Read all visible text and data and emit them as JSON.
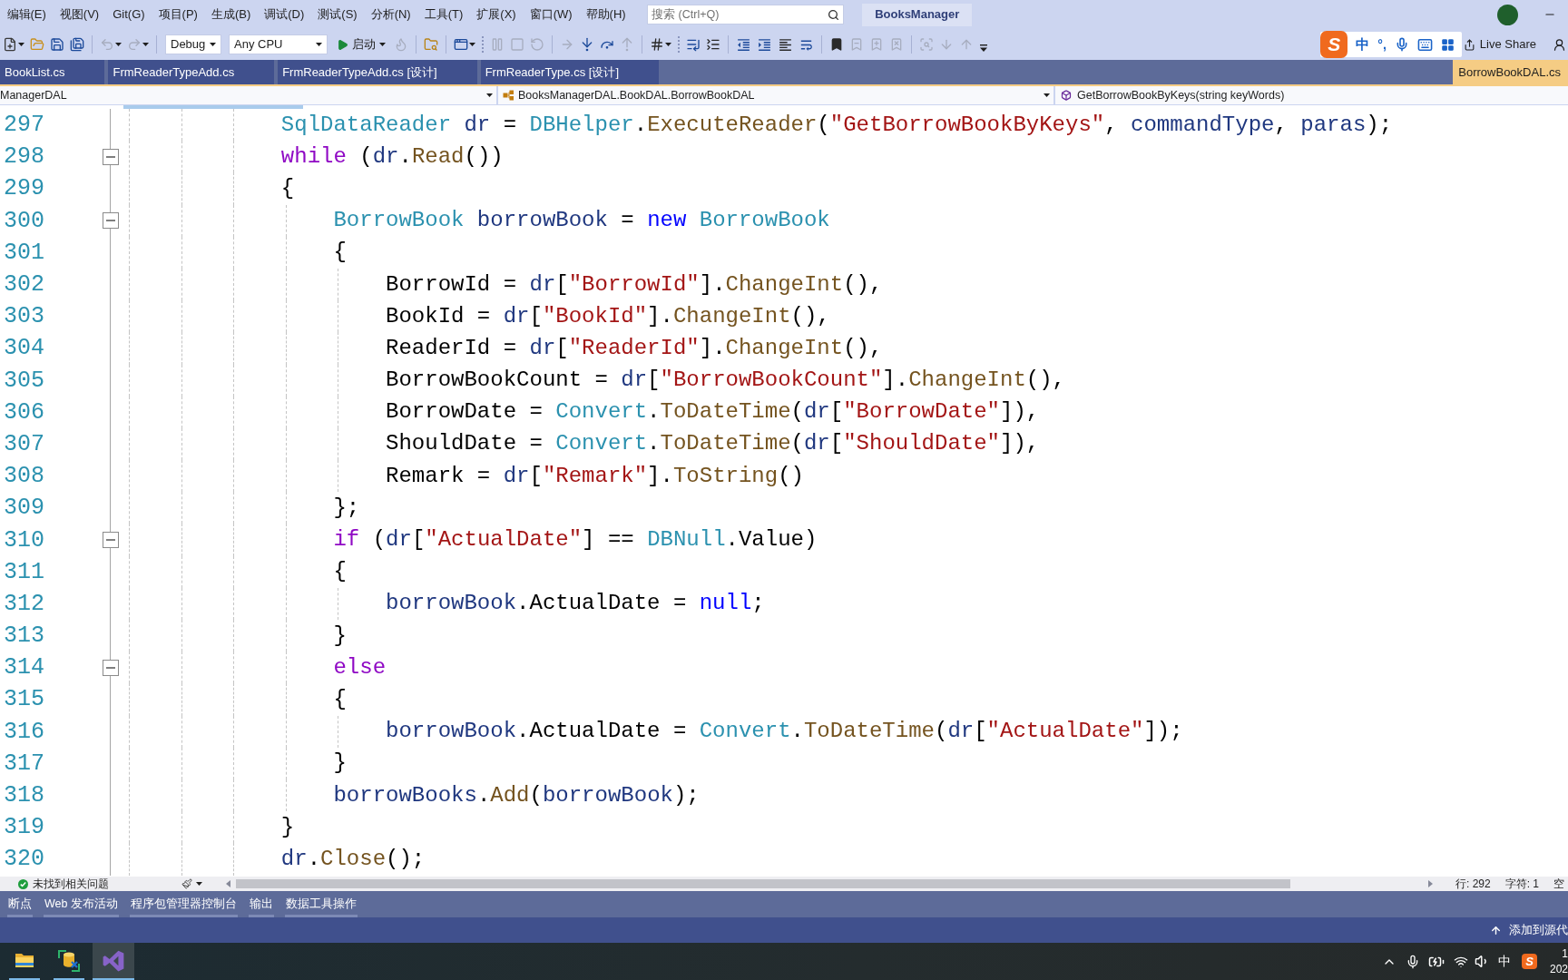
{
  "menu_bar": {
    "items": [
      "编辑(E)",
      "视图(V)",
      "Git(G)",
      "项目(P)",
      "生成(B)",
      "调试(D)",
      "测试(S)",
      "分析(N)",
      "工具(T)",
      "扩展(X)",
      "窗口(W)",
      "帮助(H)"
    ],
    "search": {
      "placeholder": "搜索 (Ctrl+Q)"
    },
    "solution": "BooksManager"
  },
  "toolbar": {
    "items": [
      {
        "kind": "new",
        "disabled": false,
        "caret": true
      },
      {
        "kind": "open",
        "disabled": false
      },
      {
        "kind": "save",
        "disabled": false
      },
      {
        "kind": "save_all",
        "disabled": false
      },
      {
        "kind": "separator"
      },
      {
        "kind": "undo",
        "disabled": true,
        "caret": true
      },
      {
        "kind": "redo",
        "disabled": true,
        "caret": true
      },
      {
        "kind": "separator"
      },
      {
        "kind": "select",
        "value": "Debug"
      },
      {
        "kind": "select",
        "value": "Any CPU"
      },
      {
        "kind": "start",
        "label": "启动"
      },
      {
        "kind": "hot_reload",
        "disabled": true
      },
      {
        "kind": "separator"
      },
      {
        "kind": "find_in_files",
        "disabled": false
      },
      {
        "kind": "separator"
      },
      {
        "kind": "window",
        "disabled": false,
        "caret": true
      },
      {
        "kind": "grip"
      },
      {
        "kind": "pause",
        "disabled": true
      },
      {
        "kind": "stop",
        "disabled": true
      },
      {
        "kind": "restart",
        "disabled": true
      },
      {
        "kind": "separator"
      },
      {
        "kind": "show_next",
        "disabled": true
      },
      {
        "kind": "step_into",
        "disabled": false
      },
      {
        "kind": "step_over",
        "disabled": false
      },
      {
        "kind": "step_out",
        "disabled": true
      },
      {
        "kind": "separator"
      },
      {
        "kind": "hash",
        "disabled": false,
        "caret": true
      },
      {
        "kind": "grip"
      },
      {
        "kind": "list_end",
        "disabled": false
      },
      {
        "kind": "list_collapse",
        "disabled": false
      },
      {
        "kind": "separator"
      },
      {
        "kind": "outdent",
        "disabled": false
      },
      {
        "kind": "indent",
        "disabled": false
      },
      {
        "kind": "comment",
        "disabled": false
      },
      {
        "kind": "uncomment",
        "disabled": false
      },
      {
        "kind": "separator"
      },
      {
        "kind": "bookmark",
        "disabled": false
      },
      {
        "kind": "bookmark_prev",
        "disabled": true
      },
      {
        "kind": "bookmark_next",
        "disabled": true
      },
      {
        "kind": "bookmark_clear",
        "disabled": true
      },
      {
        "kind": "separator"
      },
      {
        "kind": "find",
        "disabled": true
      },
      {
        "kind": "move_down",
        "disabled": true
      },
      {
        "kind": "move_up",
        "disabled": true
      },
      {
        "kind": "overflow",
        "disabled": false
      }
    ],
    "ime_bar": {
      "logo": "S",
      "mode": "中",
      "punctuation": "°,"
    },
    "live_share": "Live Share"
  },
  "tabs": [
    {
      "label": "BookList.cs",
      "kind": "document",
      "selected": false
    },
    {
      "label": "FrmReaderTypeAdd.cs",
      "kind": "document",
      "selected": false
    },
    {
      "label": "FrmReaderTypeAdd.cs [设计]",
      "kind": "document",
      "selected": false
    },
    {
      "label": "FrmReaderType.cs [设计]",
      "kind": "document",
      "selected": false
    },
    {
      "label": "BorrowBookDAL.cs",
      "kind": "preview",
      "selected": true
    }
  ],
  "navigation_bar": {
    "project": "ManagerDAL",
    "type": "BooksManagerDAL.BookDAL.BorrowBookDAL",
    "member": "GetBorrowBookByKeys(string keyWords)"
  },
  "editor": {
    "lines": [
      {
        "number": "297",
        "tokens": [
          {
            "text": "            SqlDataReader",
            "kind": "type"
          },
          {
            "text": " dr",
            "kind": "local"
          },
          {
            "text": " = ",
            "kind": "plain"
          },
          {
            "text": "DBHelper",
            "kind": "type"
          },
          {
            "text": ".",
            "kind": "plain"
          },
          {
            "text": "ExecuteReader",
            "kind": "method"
          },
          {
            "text": "(",
            "kind": "plain"
          },
          {
            "text": "\"GetBorrowBookByKeys\"",
            "kind": "string"
          },
          {
            "text": ", ",
            "kind": "plain"
          },
          {
            "text": "commandType",
            "kind": "local"
          },
          {
            "text": ", ",
            "kind": "plain"
          },
          {
            "text": "paras",
            "kind": "local"
          },
          {
            "text": ");",
            "kind": "plain"
          }
        ]
      },
      {
        "number": "298",
        "expanded": true,
        "tokens": [
          {
            "text": "            while",
            "kind": "control"
          },
          {
            "text": " (",
            "kind": "plain"
          },
          {
            "text": "dr",
            "kind": "local"
          },
          {
            "text": ".",
            "kind": "plain"
          },
          {
            "text": "Read",
            "kind": "method"
          },
          {
            "text": "())",
            "kind": "plain"
          }
        ]
      },
      {
        "number": "299",
        "tokens": [
          {
            "text": "            {",
            "kind": "plain"
          }
        ]
      },
      {
        "number": "300",
        "expanded": true,
        "tokens": [
          {
            "text": "                BorrowBook",
            "kind": "type"
          },
          {
            "text": " borrowBook",
            "kind": "local"
          },
          {
            "text": " = ",
            "kind": "plain"
          },
          {
            "text": "new",
            "kind": "keyword"
          },
          {
            "text": " BorrowBook",
            "kind": "type"
          }
        ]
      },
      {
        "number": "301",
        "tokens": [
          {
            "text": "                {",
            "kind": "plain"
          }
        ]
      },
      {
        "number": "302",
        "tokens": [
          {
            "text": "                    BorrowId = ",
            "kind": "plain"
          },
          {
            "text": "dr",
            "kind": "local"
          },
          {
            "text": "[",
            "kind": "plain"
          },
          {
            "text": "\"BorrowId\"",
            "kind": "string"
          },
          {
            "text": "].",
            "kind": "plain"
          },
          {
            "text": "ChangeInt",
            "kind": "method"
          },
          {
            "text": "(),",
            "kind": "plain"
          }
        ]
      },
      {
        "number": "303",
        "tokens": [
          {
            "text": "                    BookId = ",
            "kind": "plain"
          },
          {
            "text": "dr",
            "kind": "local"
          },
          {
            "text": "[",
            "kind": "plain"
          },
          {
            "text": "\"BookId\"",
            "kind": "string"
          },
          {
            "text": "].",
            "kind": "plain"
          },
          {
            "text": "ChangeInt",
            "kind": "method"
          },
          {
            "text": "(),",
            "kind": "plain"
          }
        ]
      },
      {
        "number": "304",
        "tokens": [
          {
            "text": "                    ReaderId = ",
            "kind": "plain"
          },
          {
            "text": "dr",
            "kind": "local"
          },
          {
            "text": "[",
            "kind": "plain"
          },
          {
            "text": "\"ReaderId\"",
            "kind": "string"
          },
          {
            "text": "].",
            "kind": "plain"
          },
          {
            "text": "ChangeInt",
            "kind": "method"
          },
          {
            "text": "(),",
            "kind": "plain"
          }
        ]
      },
      {
        "number": "305",
        "tokens": [
          {
            "text": "                    BorrowBookCount = ",
            "kind": "plain"
          },
          {
            "text": "dr",
            "kind": "local"
          },
          {
            "text": "[",
            "kind": "plain"
          },
          {
            "text": "\"BorrowBookCount\"",
            "kind": "string"
          },
          {
            "text": "].",
            "kind": "plain"
          },
          {
            "text": "ChangeInt",
            "kind": "method"
          },
          {
            "text": "(),",
            "kind": "plain"
          }
        ]
      },
      {
        "number": "306",
        "tokens": [
          {
            "text": "                    BorrowDate = ",
            "kind": "plain"
          },
          {
            "text": "Convert",
            "kind": "type"
          },
          {
            "text": ".",
            "kind": "plain"
          },
          {
            "text": "ToDateTime",
            "kind": "method"
          },
          {
            "text": "(",
            "kind": "plain"
          },
          {
            "text": "dr",
            "kind": "local"
          },
          {
            "text": "[",
            "kind": "plain"
          },
          {
            "text": "\"BorrowDate\"",
            "kind": "string"
          },
          {
            "text": "]),",
            "kind": "plain"
          }
        ]
      },
      {
        "number": "307",
        "tokens": [
          {
            "text": "                    ShouldDate = ",
            "kind": "plain"
          },
          {
            "text": "Convert",
            "kind": "type"
          },
          {
            "text": ".",
            "kind": "plain"
          },
          {
            "text": "ToDateTime",
            "kind": "method"
          },
          {
            "text": "(",
            "kind": "plain"
          },
          {
            "text": "dr",
            "kind": "local"
          },
          {
            "text": "[",
            "kind": "plain"
          },
          {
            "text": "\"ShouldDate\"",
            "kind": "string"
          },
          {
            "text": "]),",
            "kind": "plain"
          }
        ]
      },
      {
        "number": "308",
        "tokens": [
          {
            "text": "                    Remark = ",
            "kind": "plain"
          },
          {
            "text": "dr",
            "kind": "local"
          },
          {
            "text": "[",
            "kind": "plain"
          },
          {
            "text": "\"Remark\"",
            "kind": "string"
          },
          {
            "text": "].",
            "kind": "plain"
          },
          {
            "text": "ToString",
            "kind": "method"
          },
          {
            "text": "()",
            "kind": "plain"
          }
        ]
      },
      {
        "number": "309",
        "tokens": [
          {
            "text": "                };",
            "kind": "plain"
          }
        ]
      },
      {
        "number": "310",
        "expanded": true,
        "tokens": [
          {
            "text": "                if",
            "kind": "control"
          },
          {
            "text": " (",
            "kind": "plain"
          },
          {
            "text": "dr",
            "kind": "local"
          },
          {
            "text": "[",
            "kind": "plain"
          },
          {
            "text": "\"ActualDate\"",
            "kind": "string"
          },
          {
            "text": "] == ",
            "kind": "plain"
          },
          {
            "text": "DBNull",
            "kind": "type"
          },
          {
            "text": ".Value)",
            "kind": "plain"
          }
        ]
      },
      {
        "number": "311",
        "tokens": [
          {
            "text": "                {",
            "kind": "plain"
          }
        ]
      },
      {
        "number": "312",
        "tokens": [
          {
            "text": "                    borrowBook",
            "kind": "local"
          },
          {
            "text": ".ActualDate = ",
            "kind": "plain"
          },
          {
            "text": "null",
            "kind": "keyword"
          },
          {
            "text": ";",
            "kind": "plain"
          }
        ]
      },
      {
        "number": "313",
        "tokens": [
          {
            "text": "                }",
            "kind": "plain"
          }
        ]
      },
      {
        "number": "314",
        "expanded": true,
        "tokens": [
          {
            "text": "                else",
            "kind": "control"
          }
        ]
      },
      {
        "number": "315",
        "tokens": [
          {
            "text": "                {",
            "kind": "plain"
          }
        ]
      },
      {
        "number": "316",
        "tokens": [
          {
            "text": "                    borrowBook",
            "kind": "local"
          },
          {
            "text": ".ActualDate = ",
            "kind": "plain"
          },
          {
            "text": "Convert",
            "kind": "type"
          },
          {
            "text": ".",
            "kind": "plain"
          },
          {
            "text": "ToDateTime",
            "kind": "method"
          },
          {
            "text": "(",
            "kind": "plain"
          },
          {
            "text": "dr",
            "kind": "local"
          },
          {
            "text": "[",
            "kind": "plain"
          },
          {
            "text": "\"ActualDate\"",
            "kind": "string"
          },
          {
            "text": "]);",
            "kind": "plain"
          }
        ]
      },
      {
        "number": "317",
        "tokens": [
          {
            "text": "                }",
            "kind": "plain"
          }
        ]
      },
      {
        "number": "318",
        "tokens": [
          {
            "text": "                borrowBooks",
            "kind": "local"
          },
          {
            "text": ".",
            "kind": "plain"
          },
          {
            "text": "Add",
            "kind": "method"
          },
          {
            "text": "(",
            "kind": "plain"
          },
          {
            "text": "borrowBook",
            "kind": "local"
          },
          {
            "text": ");",
            "kind": "plain"
          }
        ]
      },
      {
        "number": "319",
        "tokens": [
          {
            "text": "            }",
            "kind": "plain"
          }
        ]
      },
      {
        "number": "320",
        "tokens": [
          {
            "text": "            dr",
            "kind": "local"
          },
          {
            "text": ".",
            "kind": "plain"
          },
          {
            "text": "Close",
            "kind": "method"
          },
          {
            "text": "();",
            "kind": "plain"
          }
        ]
      }
    ]
  },
  "status_row": {
    "issues": "未找到相关问题",
    "line": "行: 292",
    "column": "字符: 1",
    "spacing": "空"
  },
  "tool_windows": [
    "断点",
    "Web 发布活动",
    "程序包管理器控制台",
    "输出",
    "数据工具操作"
  ],
  "status_bar": {
    "source_control": "添加到源代"
  },
  "taskbar": {
    "apps": [
      {
        "kind": "folder",
        "running": true,
        "selected": false
      },
      {
        "kind": "database",
        "running": true,
        "selected": false
      },
      {
        "kind": "logo",
        "running": true,
        "selected": true
      }
    ],
    "tray": {
      "ime_mode": "中",
      "ime_logo": "S"
    },
    "clock": {
      "time": "1",
      "date": "202"
    }
  }
}
